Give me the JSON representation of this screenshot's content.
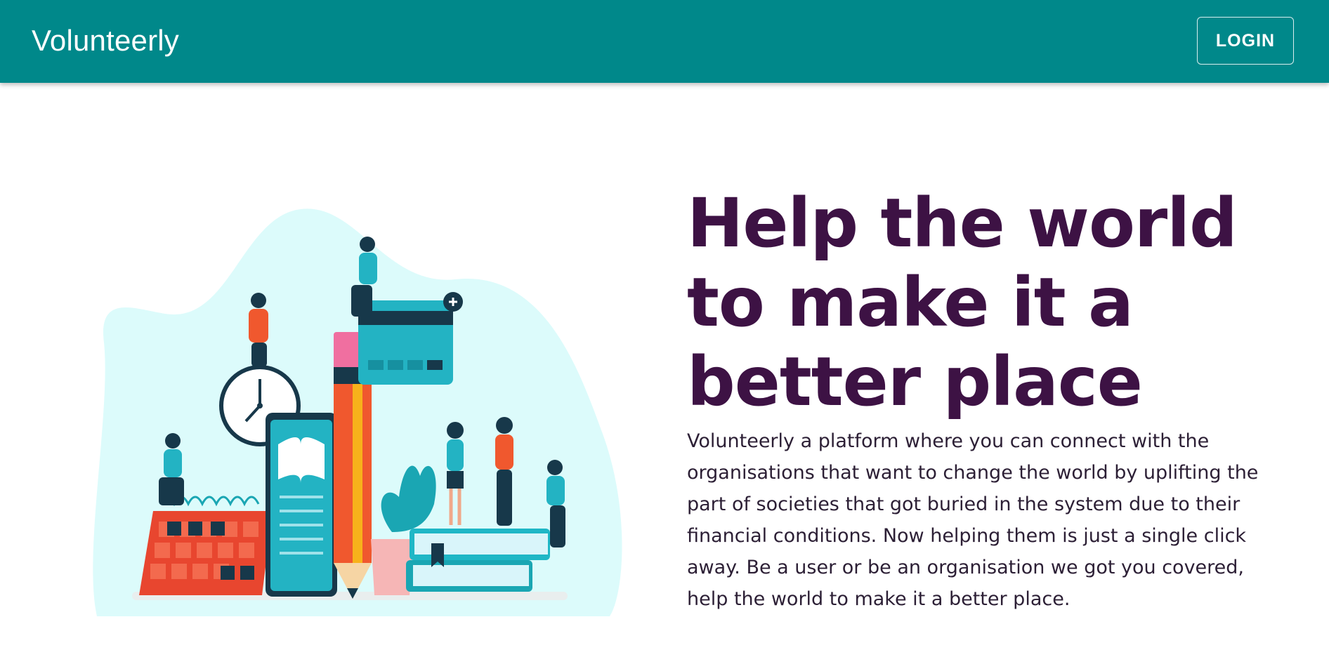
{
  "header": {
    "brand": "Volunteerly",
    "login_label": "LOGIN",
    "background_color": "#00888a"
  },
  "hero": {
    "headline": "Help the world to make it a better place",
    "description": "Volunteerly a platform where you can connect with the organisations that want to change the world by uplifting the part of societies that got buried in the system due to their financial conditions. Now helping them is just a single click away. Be a user or be an organisation we got you covered, help the world to make it a better place.",
    "headline_color": "#3d1244",
    "illustration": "students-education-illustration"
  }
}
